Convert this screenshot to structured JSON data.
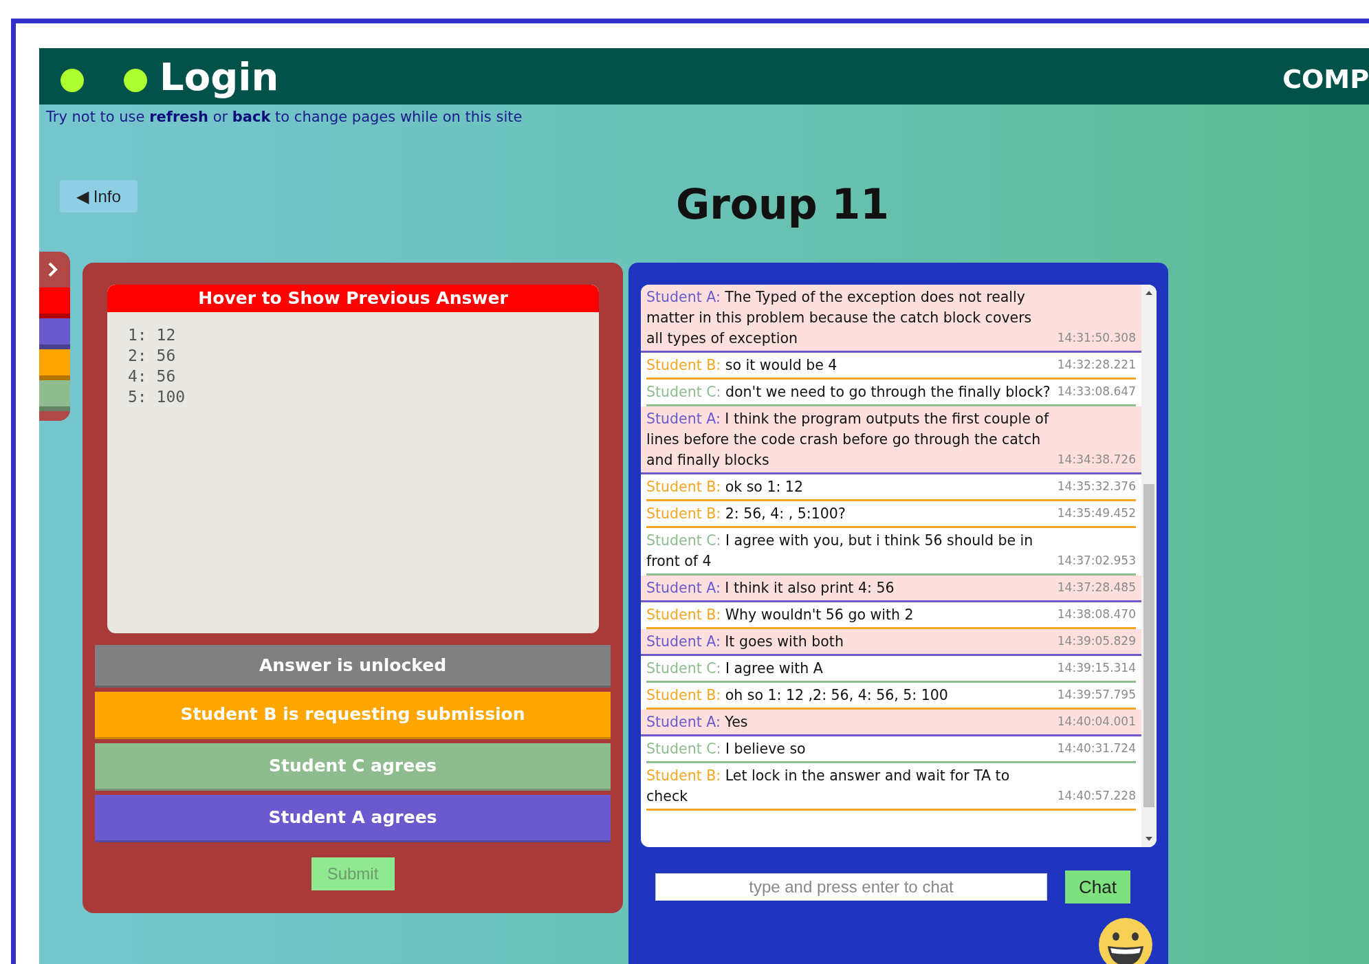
{
  "header": {
    "title": "Login",
    "right_text": "COMP"
  },
  "notice": "Try not to use **refresh** or **back** to change pages while on this site",
  "info_button": {
    "label": "◀ Info"
  },
  "group_title": "Group 11",
  "sidebar": {
    "segments": [
      {
        "color": "#ff0000"
      },
      {
        "color": "#6a5acd"
      },
      {
        "color": "#ffa500"
      },
      {
        "color": "#8fbc8f"
      }
    ]
  },
  "answer_panel": {
    "header": "Hover to Show Previous Answer",
    "lines": [
      "1: 12",
      "2: 56",
      "4: 56",
      "5: 100"
    ],
    "statuses": [
      {
        "text": "Answer is unlocked",
        "color": "#808080"
      },
      {
        "text": "Student B is requesting submission",
        "color": "#ffa500"
      },
      {
        "text": "Student C agrees",
        "color": "#8fbc8f"
      },
      {
        "text": "Student A agrees",
        "color": "#6a5acd"
      }
    ],
    "submit": {
      "label": "Submit",
      "disabled": true
    }
  },
  "chat": {
    "messages": [
      {
        "sender": "Student A:",
        "text": "The Typed of the exception does not really matter in this problem because the catch block covers all types of exception",
        "time": "14:31:50.308",
        "color": "#6a5acd",
        "highlighted": true
      },
      {
        "sender": "Student B:",
        "text": "so it would be 4",
        "time": "14:32:28.221",
        "color": "#f5a623",
        "highlighted": false
      },
      {
        "sender": "Student C:",
        "text": "don't we need to go through the finally block?",
        "time": "14:33:08.647",
        "color": "#8fbc8f",
        "highlighted": false
      },
      {
        "sender": "Student A:",
        "text": "I think the program outputs the first couple of lines before the code crash before go through the catch and finally blocks",
        "time": "14:34:38.726",
        "color": "#6a5acd",
        "highlighted": true
      },
      {
        "sender": "Student B:",
        "text": "ok so 1: 12",
        "time": "14:35:32.376",
        "color": "#f5a623",
        "highlighted": false
      },
      {
        "sender": "Student B:",
        "text": "2: 56, 4: , 5:100?",
        "time": "14:35:49.452",
        "color": "#f5a623",
        "highlighted": false
      },
      {
        "sender": "Student C:",
        "text": "I agree with you, but i think 56 should be in front of 4",
        "time": "14:37:02.953",
        "color": "#8fbc8f",
        "highlighted": false
      },
      {
        "sender": "Student A:",
        "text": "I think it also print 4: 56",
        "time": "14:37:28.485",
        "color": "#6a5acd",
        "highlighted": true
      },
      {
        "sender": "Student B:",
        "text": "Why wouldn't 56 go with 2",
        "time": "14:38:08.470",
        "color": "#f5a623",
        "highlighted": false
      },
      {
        "sender": "Student A:",
        "text": "It goes with both",
        "time": "14:39:05.829",
        "color": "#6a5acd",
        "highlighted": true
      },
      {
        "sender": "Student C:",
        "text": "I agree with A",
        "time": "14:39:15.314",
        "color": "#8fbc8f",
        "highlighted": false
      },
      {
        "sender": "Student B:",
        "text": "oh so 1: 12 ,2: 56, 4: 56, 5: 100",
        "time": "14:39:57.795",
        "color": "#f5a623",
        "highlighted": false
      },
      {
        "sender": "Student A:",
        "text": "Yes",
        "time": "14:40:04.001",
        "color": "#6a5acd",
        "highlighted": true
      },
      {
        "sender": "Student C:",
        "text": "I believe so",
        "time": "14:40:31.724",
        "color": "#8fbc8f",
        "highlighted": false
      },
      {
        "sender": "Student B:",
        "text": "Let lock in the answer and wait for TA to check",
        "time": "14:40:57.228",
        "color": "#f5a623",
        "highlighted": false
      }
    ],
    "input": {
      "placeholder": "type and press enter to chat"
    },
    "send_button": {
      "label": "Chat"
    }
  }
}
